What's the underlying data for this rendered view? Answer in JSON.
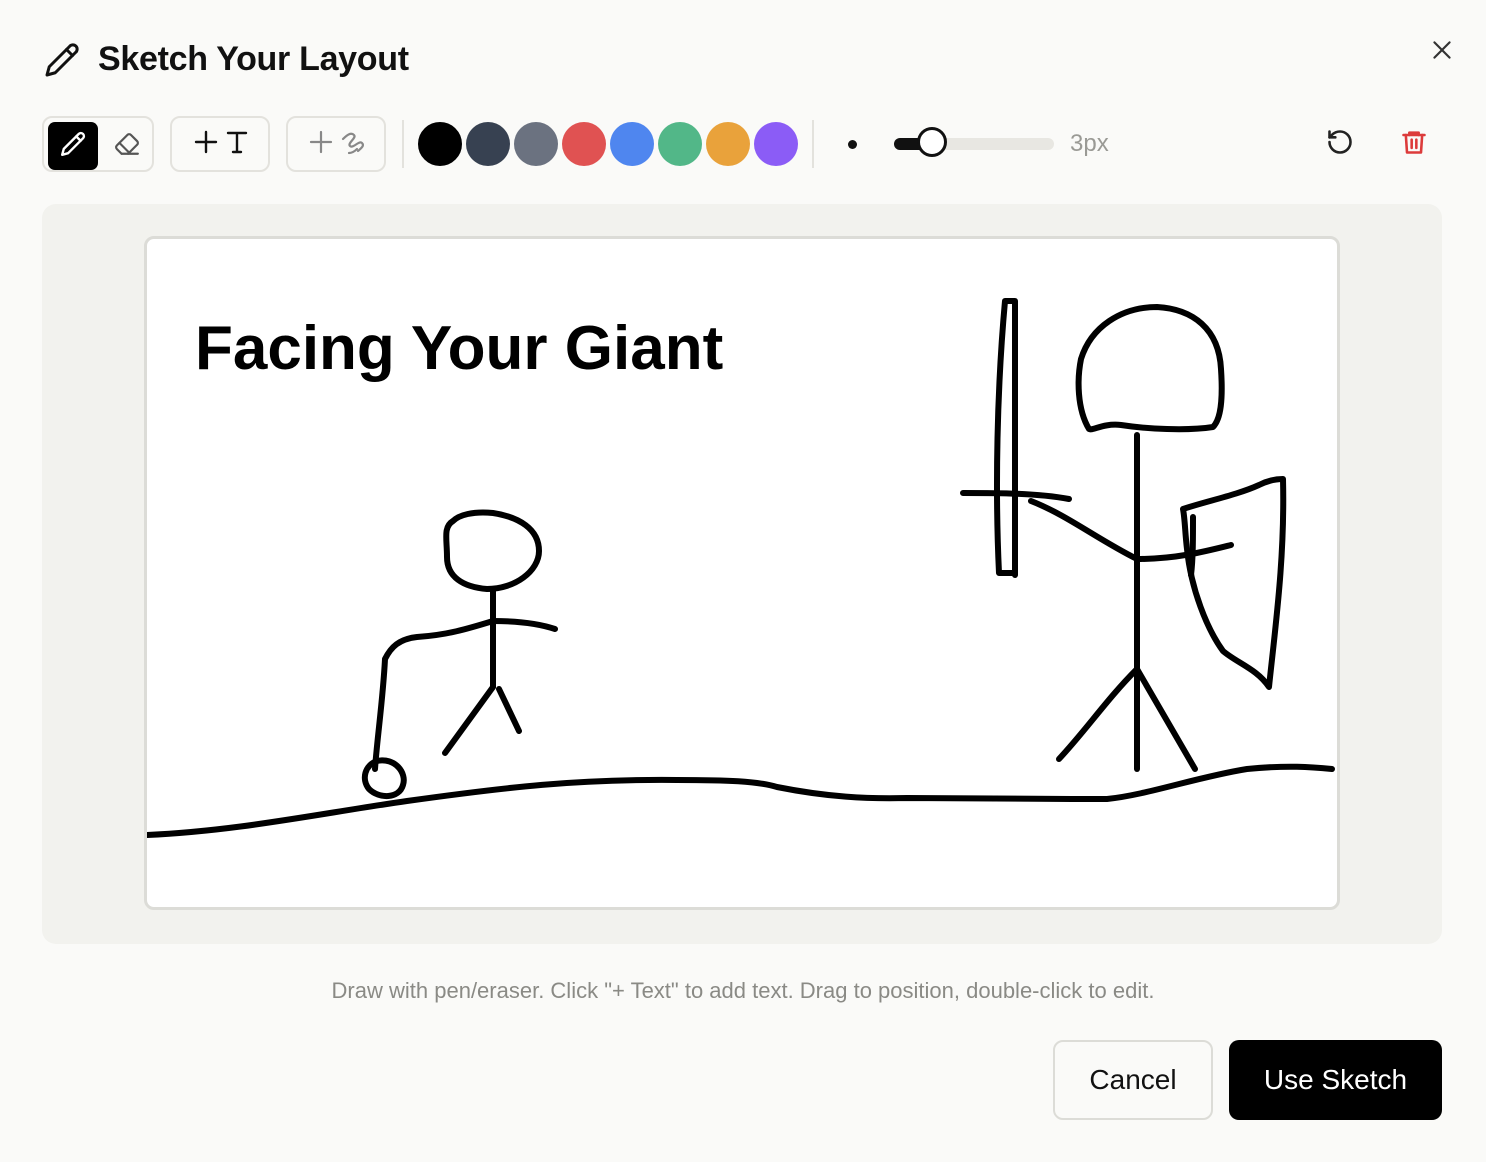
{
  "dialog": {
    "title": "Sketch Your Layout",
    "title_icon": "pencil-icon",
    "close_icon": "close-icon"
  },
  "toolbar": {
    "pen_icon": "pencil-icon",
    "eraser_icon": "eraser-icon",
    "active_tool": "pen",
    "add_text_icon": "add-text-icon",
    "add_shape_icon": "add-shape-icon",
    "colors": [
      "#000000",
      "#374151",
      "#6b7280",
      "#e05252",
      "#4f86ef",
      "#52b788",
      "#e9a23b",
      "#8b5cf6"
    ],
    "selected_color": "#000000",
    "brush_size_label": "3px",
    "brush_size_fraction": 0.18,
    "undo_icon": "undo-icon",
    "clear_icon": "trash-icon",
    "clear_color": "#dc3b3b"
  },
  "canvas": {
    "text_label": "Facing Your Giant"
  },
  "hint": "Draw with pen/eraser. Click \"+ Text\" to add text. Drag to position, double-click to edit.",
  "footer": {
    "cancel_label": "Cancel",
    "use_label": "Use Sketch"
  }
}
